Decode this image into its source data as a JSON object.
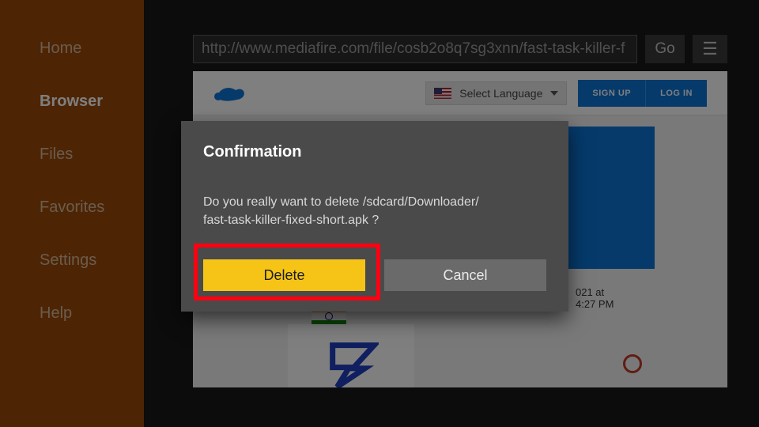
{
  "sidebar": {
    "items": [
      {
        "label": "Home"
      },
      {
        "label": "Browser"
      },
      {
        "label": "Files"
      },
      {
        "label": "Favorites"
      },
      {
        "label": "Settings"
      },
      {
        "label": "Help"
      }
    ],
    "activeIndex": 1
  },
  "addressBar": {
    "url": "http://www.mediafire.com/file/cosb2o8q7sg3xnn/fast-task-killer-f",
    "goLabel": "Go",
    "menuGlyph": "☰"
  },
  "webpage": {
    "languageSelector": "Select Language",
    "signUp": "SIGN UP",
    "logIn": "LOG IN",
    "dateFragment1": "021 at",
    "dateFragment2": "4:27 PM"
  },
  "dialog": {
    "title": "Confirmation",
    "message": "Do you really want to delete /sdcard/Downloader/\nfast-task-killer-fixed-short.apk ?",
    "deleteLabel": "Delete",
    "cancelLabel": "Cancel"
  }
}
